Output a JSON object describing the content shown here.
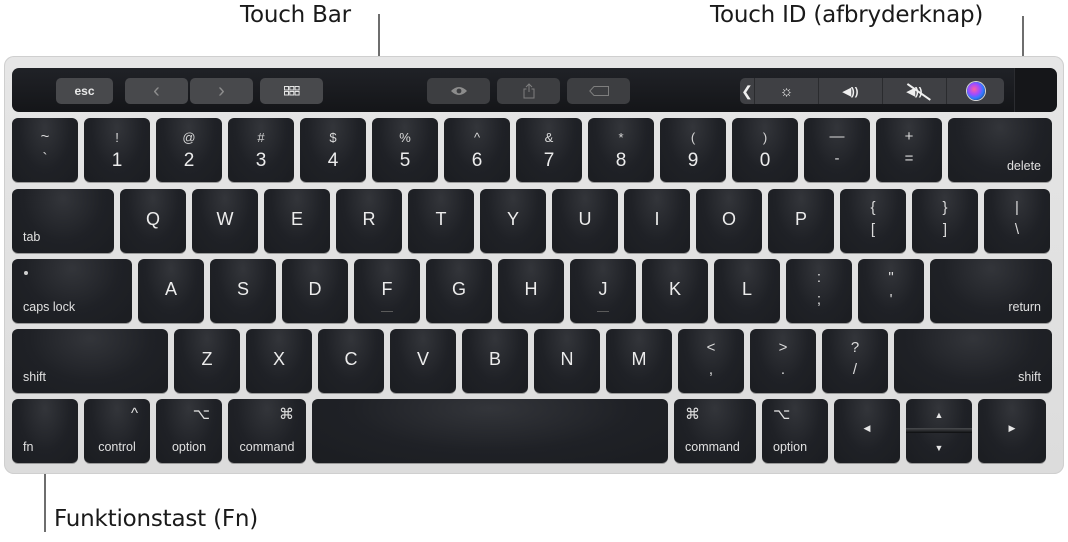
{
  "callouts": {
    "touch_bar": "Touch Bar",
    "touch_id": "Touch ID (afbryderknap)",
    "fn_key": "Funktionstast (Fn)"
  },
  "touch_bar": {
    "esc": "esc",
    "back_icon": "chevron-left",
    "forward_icon": "chevron-right",
    "grid_icon": "app-grid",
    "eye_icon": "quick-look-eye",
    "share_icon": "share",
    "tag_icon": "tag",
    "control_strip": {
      "collapse_icon": "chevron-left",
      "brightness_icon": "brightness-sun",
      "volume_icon": "speaker-volume",
      "mute_icon": "speaker-mute",
      "siri_icon": "siri"
    },
    "glyphs": {
      "back": "‹",
      "forward": "›",
      "collapse": "❮",
      "brightness": "☼",
      "volume": "◀))",
      "mute": "◀))"
    }
  },
  "keyboard": {
    "row1": [
      {
        "top": "~",
        "main": "`"
      },
      {
        "top": "!",
        "main": "1"
      },
      {
        "top": "@",
        "main": "2"
      },
      {
        "top": "#",
        "main": "3"
      },
      {
        "top": "$",
        "main": "4"
      },
      {
        "top": "%",
        "main": "5"
      },
      {
        "top": "^",
        "main": "6"
      },
      {
        "top": "&",
        "main": "7"
      },
      {
        "top": "*",
        "main": "8"
      },
      {
        "top": "(",
        "main": "9"
      },
      {
        "top": ")",
        "main": "0"
      },
      {
        "top": "—",
        "main": "-"
      },
      {
        "top": "+",
        "main": "="
      },
      {
        "label": "delete"
      }
    ],
    "row2": [
      {
        "label": "tab"
      },
      {
        "main": "Q"
      },
      {
        "main": "W"
      },
      {
        "main": "E"
      },
      {
        "main": "R"
      },
      {
        "main": "T"
      },
      {
        "main": "Y"
      },
      {
        "main": "U"
      },
      {
        "main": "I"
      },
      {
        "main": "O"
      },
      {
        "main": "P"
      },
      {
        "top": "{",
        "main": "["
      },
      {
        "top": "}",
        "main": "]"
      },
      {
        "top": "|",
        "main": "\\"
      }
    ],
    "row3": [
      {
        "label": "caps lock"
      },
      {
        "main": "A"
      },
      {
        "main": "S"
      },
      {
        "main": "D"
      },
      {
        "main": "F"
      },
      {
        "main": "G"
      },
      {
        "main": "H"
      },
      {
        "main": "J"
      },
      {
        "main": "K"
      },
      {
        "main": "L"
      },
      {
        "top": ":",
        "main": ";"
      },
      {
        "top": "\"",
        "main": "'"
      },
      {
        "label": "return"
      }
    ],
    "row4": [
      {
        "label": "shift"
      },
      {
        "main": "Z"
      },
      {
        "main": "X"
      },
      {
        "main": "C"
      },
      {
        "main": "V"
      },
      {
        "main": "B"
      },
      {
        "main": "N"
      },
      {
        "main": "M"
      },
      {
        "top": "<",
        "main": ","
      },
      {
        "top": ">",
        "main": "."
      },
      {
        "top": "?",
        "main": "/"
      },
      {
        "label": "shift"
      }
    ],
    "row5": [
      {
        "label": "fn"
      },
      {
        "glyph": "^",
        "label": "control"
      },
      {
        "glyph": "⌥",
        "label": "option"
      },
      {
        "glyph": "⌘",
        "label": "command"
      },
      {
        "label": ""
      },
      {
        "glyph": "⌘",
        "label": "command"
      },
      {
        "glyph": "⌥",
        "label": "option"
      },
      {
        "arrow": "◀"
      },
      {
        "arrow_up": "▲",
        "arrow_down": "▼"
      },
      {
        "arrow": "▶"
      }
    ]
  }
}
